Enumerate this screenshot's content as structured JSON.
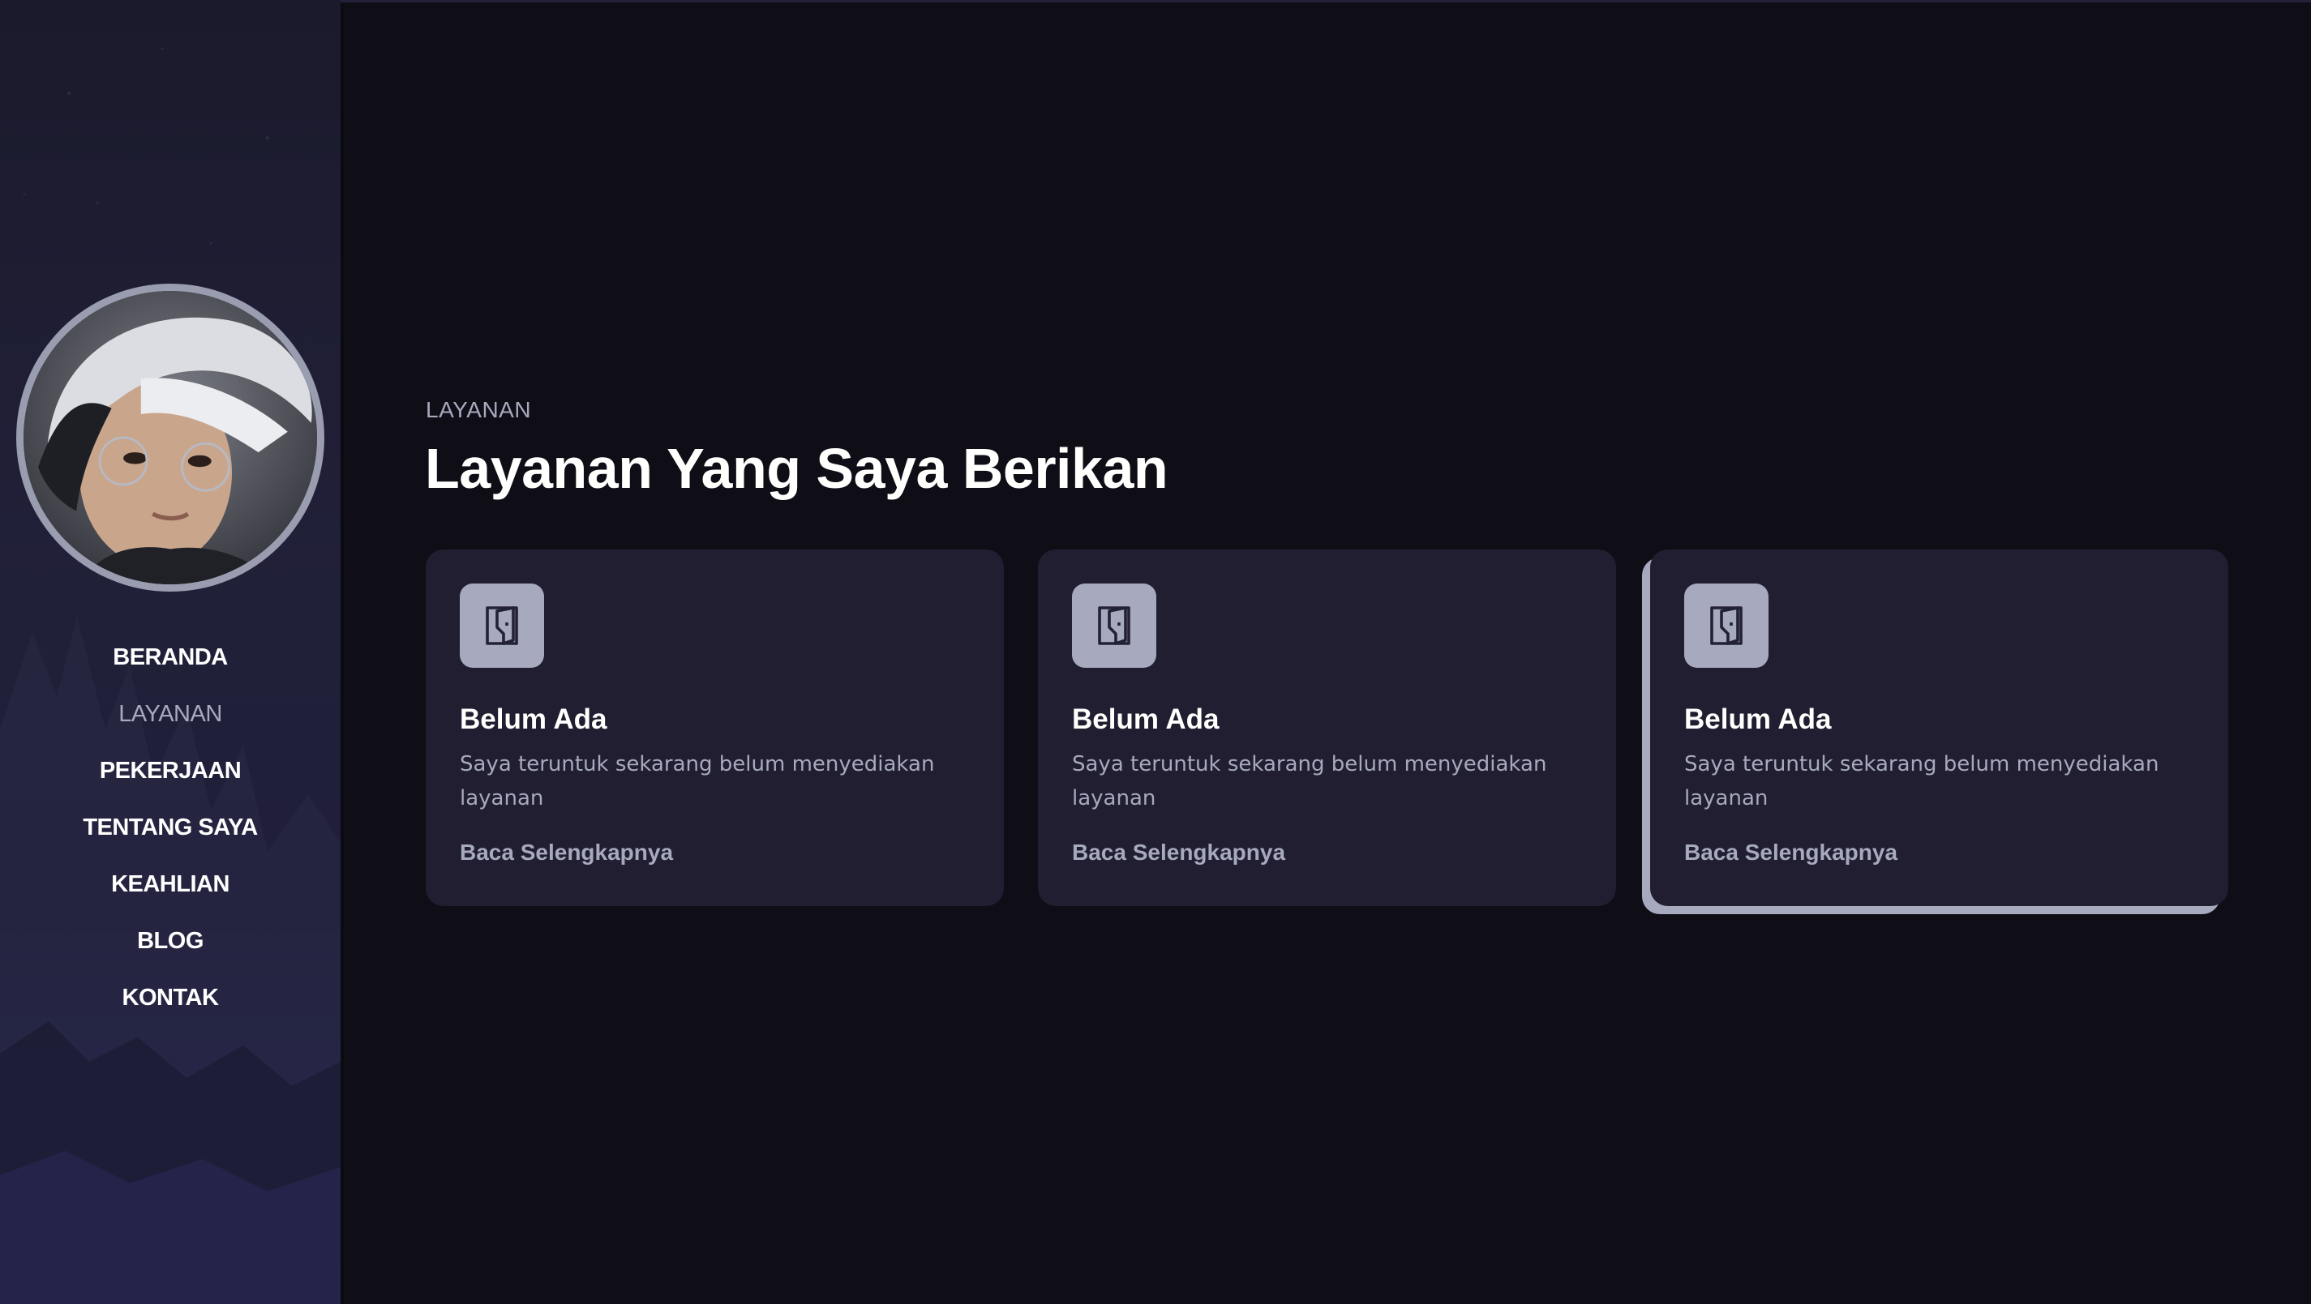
{
  "colors": {
    "background": "#0f0e17",
    "card": "#201e30",
    "accent": "#a7a9be",
    "heading": "#fffffe"
  },
  "sidebar": {
    "nav": [
      {
        "label": "BERANDA",
        "active": false
      },
      {
        "label": "LAYANAN",
        "active": true
      },
      {
        "label": "PEKERJAAN",
        "active": false
      },
      {
        "label": "TENTANG SAYA",
        "active": false
      },
      {
        "label": "KEAHLIAN",
        "active": false
      },
      {
        "label": "BLOG",
        "active": false
      },
      {
        "label": "KONTAK",
        "active": false
      }
    ]
  },
  "services": {
    "eyebrow": "LAYANAN",
    "title": "Layanan Yang Saya Berikan",
    "cards": [
      {
        "icon": "door-icon",
        "title": "Belum Ada",
        "text": "Saya teruntuk sekarang belum menyediakan layanan",
        "link": "Baca Selengkapnya"
      },
      {
        "icon": "door-icon",
        "title": "Belum Ada",
        "text": "Saya teruntuk sekarang belum menyediakan layanan",
        "link": "Baca Selengkapnya"
      },
      {
        "icon": "door-icon",
        "title": "Belum Ada",
        "text": "Saya teruntuk sekarang belum menyediakan layanan",
        "link": "Baca Selengkapnya"
      }
    ]
  }
}
